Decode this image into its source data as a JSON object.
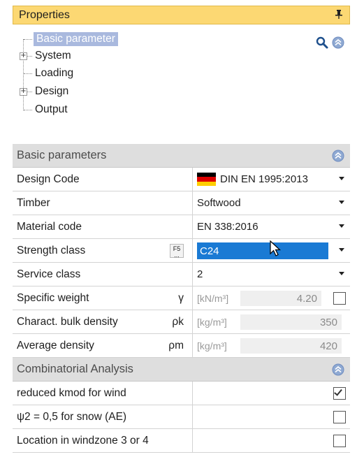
{
  "panel": {
    "title": "Properties",
    "pin_glyph": "1"
  },
  "tree": {
    "items": [
      {
        "label": "Basic parameter",
        "expandable": false,
        "selected": true
      },
      {
        "label": "System",
        "expandable": true
      },
      {
        "label": "Loading",
        "expandable": false
      },
      {
        "label": "Design",
        "expandable": true
      },
      {
        "label": "Output",
        "expandable": false
      }
    ],
    "expander_glyph": "+"
  },
  "icons": {
    "search": "search-icon",
    "collapse_all": "chevron-up-circle-icon"
  },
  "basic": {
    "header": "Basic parameters",
    "design_code": {
      "name": "Design Code",
      "value": "DIN EN 1995:2013",
      "flag_colors": [
        "#000000",
        "#dd0000",
        "#ffce00"
      ]
    },
    "timber": {
      "name": "Timber",
      "value": "Softwood"
    },
    "material_code": {
      "name": "Material code",
      "value": "EN 338:2016"
    },
    "strength_class": {
      "name": "Strength class",
      "value": "C24",
      "button": "F5",
      "button_dots": "..."
    },
    "service_class": {
      "name": "Service class",
      "value": "2"
    },
    "specific_weight": {
      "name": "Specific weight",
      "symbol": "γ",
      "unit": "[kN/m³]",
      "value": "4.20",
      "checked": false
    },
    "bulk_density": {
      "name": "Charact. bulk density",
      "symbol": "ρk",
      "unit": "[kg/m³]",
      "value": "350"
    },
    "avg_density": {
      "name": "Average density",
      "symbol": "ρm",
      "unit": "[kg/m³]",
      "value": "420"
    }
  },
  "combinatorial": {
    "header": "Combinatorial Analysis",
    "rows": [
      {
        "name": "reduced kmod for wind",
        "checked": true
      },
      {
        "name": "ψ2 = 0,5 for snow (AE)",
        "checked": false
      },
      {
        "name": "Location in windzone 3 or 4",
        "checked": false
      }
    ]
  },
  "colors": {
    "header_bg": "#fcd873",
    "selection": "#1a7ad4",
    "tree_selection": "#a9b9de",
    "section_bg": "#dedede"
  }
}
